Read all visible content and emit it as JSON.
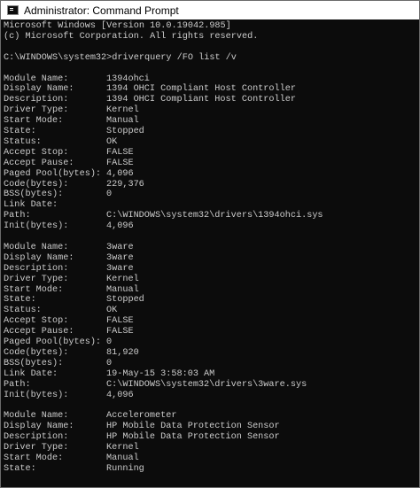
{
  "window": {
    "title": "Administrator: Command Prompt",
    "icon": "command-prompt-icon",
    "background": "#0c0c0c",
    "foreground": "#cccccc"
  },
  "console": {
    "header": [
      "Microsoft Windows [Version 10.0.19042.985]",
      "(c) Microsoft Corporation. All rights reserved."
    ],
    "prompt": "C:\\WINDOWS\\system32>",
    "command": "driverquery /FO list /v",
    "records": [
      [
        {
          "label": "Module Name:",
          "value": "1394ohci"
        },
        {
          "label": "Display Name:",
          "value": "1394 OHCI Compliant Host Controller"
        },
        {
          "label": "Description:",
          "value": "1394 OHCI Compliant Host Controller"
        },
        {
          "label": "Driver Type:",
          "value": "Kernel"
        },
        {
          "label": "Start Mode:",
          "value": "Manual"
        },
        {
          "label": "State:",
          "value": "Stopped"
        },
        {
          "label": "Status:",
          "value": "OK"
        },
        {
          "label": "Accept Stop:",
          "value": "FALSE"
        },
        {
          "label": "Accept Pause:",
          "value": "FALSE"
        },
        {
          "label": "Paged Pool(bytes):",
          "value": "4,096"
        },
        {
          "label": "Code(bytes):",
          "value": "229,376"
        },
        {
          "label": "BSS(bytes):",
          "value": "0"
        },
        {
          "label": "Link Date:",
          "value": ""
        },
        {
          "label": "Path:",
          "value": "C:\\WINDOWS\\system32\\drivers\\1394ohci.sys"
        },
        {
          "label": "Init(bytes):",
          "value": "4,096"
        }
      ],
      [
        {
          "label": "Module Name:",
          "value": "3ware"
        },
        {
          "label": "Display Name:",
          "value": "3ware"
        },
        {
          "label": "Description:",
          "value": "3ware"
        },
        {
          "label": "Driver Type:",
          "value": "Kernel"
        },
        {
          "label": "Start Mode:",
          "value": "Manual"
        },
        {
          "label": "State:",
          "value": "Stopped"
        },
        {
          "label": "Status:",
          "value": "OK"
        },
        {
          "label": "Accept Stop:",
          "value": "FALSE"
        },
        {
          "label": "Accept Pause:",
          "value": "FALSE"
        },
        {
          "label": "Paged Pool(bytes):",
          "value": "0"
        },
        {
          "label": "Code(bytes):",
          "value": "81,920"
        },
        {
          "label": "BSS(bytes):",
          "value": "0"
        },
        {
          "label": "Link Date:",
          "value": "19-May-15 3:58:03 AM"
        },
        {
          "label": "Path:",
          "value": "C:\\WINDOWS\\system32\\drivers\\3ware.sys"
        },
        {
          "label": "Init(bytes):",
          "value": "4,096"
        }
      ],
      [
        {
          "label": "Module Name:",
          "value": "Accelerometer"
        },
        {
          "label": "Display Name:",
          "value": "HP Mobile Data Protection Sensor"
        },
        {
          "label": "Description:",
          "value": "HP Mobile Data Protection Sensor"
        },
        {
          "label": "Driver Type:",
          "value": "Kernel"
        },
        {
          "label": "Start Mode:",
          "value": "Manual"
        },
        {
          "label": "State:",
          "value": "Running"
        }
      ]
    ]
  }
}
